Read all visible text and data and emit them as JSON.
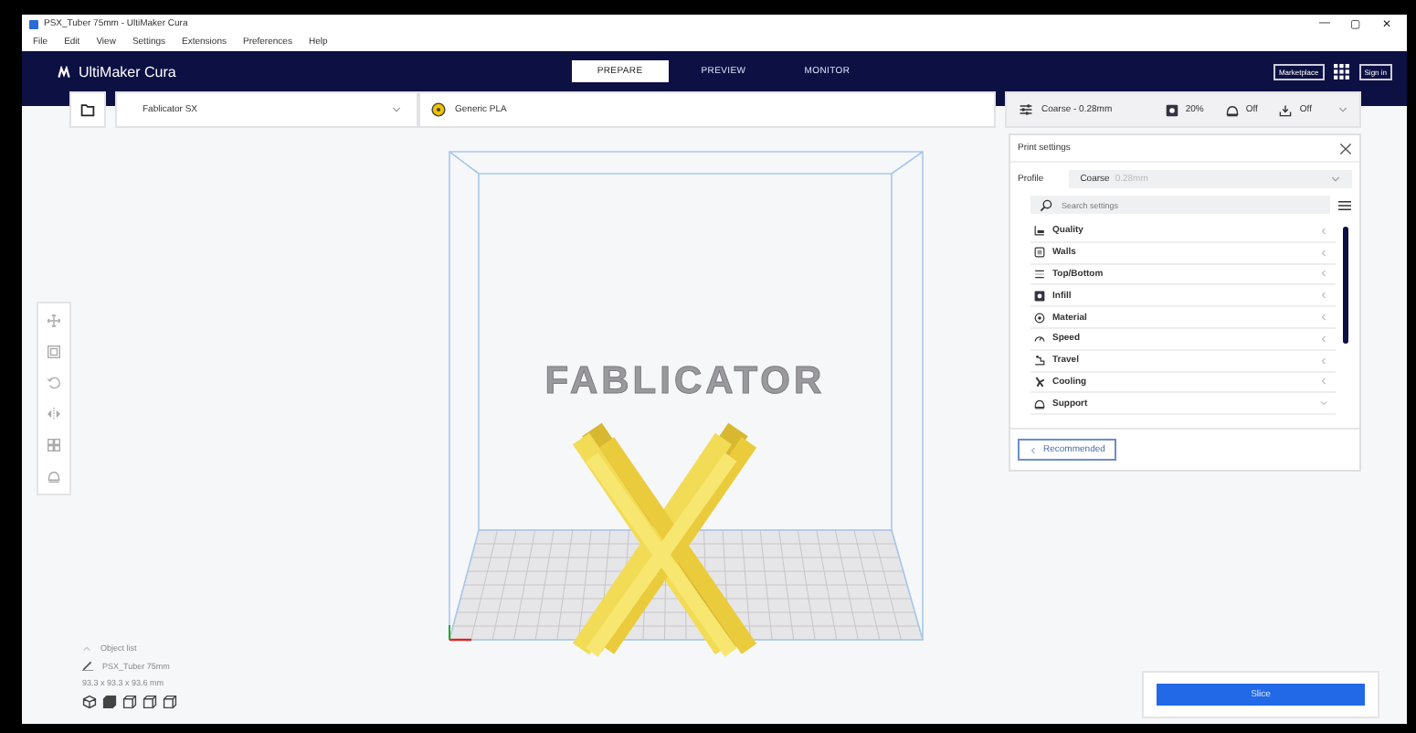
{
  "window": {
    "title": "PSX_Tuber 75mm - UltiMaker Cura",
    "controls": [
      "—",
      "▢",
      "✕"
    ]
  },
  "menu": [
    "File",
    "Edit",
    "View",
    "Settings",
    "Extensions",
    "Preferences",
    "Help"
  ],
  "header": {
    "logo": "UltiMaker Cura",
    "tabs": [
      {
        "label": "PREPARE",
        "selected": true
      },
      {
        "label": "PREVIEW",
        "selected": false
      },
      {
        "label": "MONITOR",
        "selected": false
      }
    ],
    "marketplace": "Marketplace",
    "sign_in": "Sign in"
  },
  "toolbar": {
    "printer": "Fablicator SX",
    "material": "Generic PLA",
    "profile": "Coarse - 0.28mm",
    "infill": "20%",
    "support": "Off",
    "adhesion": "Off"
  },
  "viewport": {
    "brand": "FABLICATOR"
  },
  "print_settings": {
    "title": "Print settings",
    "profile_label": "Profile",
    "profile": "Coarse",
    "profile_detail": "0.28mm",
    "search": {
      "placeholder": "Search settings"
    },
    "categories": [
      {
        "label": "Quality",
        "expanded": false
      },
      {
        "label": "Walls",
        "expanded": false
      },
      {
        "label": "Top/Bottom",
        "expanded": false
      },
      {
        "label": "Infill",
        "expanded": false
      },
      {
        "label": "Material",
        "expanded": false
      },
      {
        "label": "Speed",
        "expanded": false
      },
      {
        "label": "Travel",
        "expanded": false
      },
      {
        "label": "Cooling",
        "expanded": false
      },
      {
        "label": "Support",
        "expanded": true
      }
    ],
    "recommended": "Recommended"
  },
  "object_list": {
    "title": "Object list",
    "object": "PSX_Tuber 75mm",
    "dimensions": "93.3 x 93.3 x 93.6 mm"
  },
  "slice": "Slice"
}
